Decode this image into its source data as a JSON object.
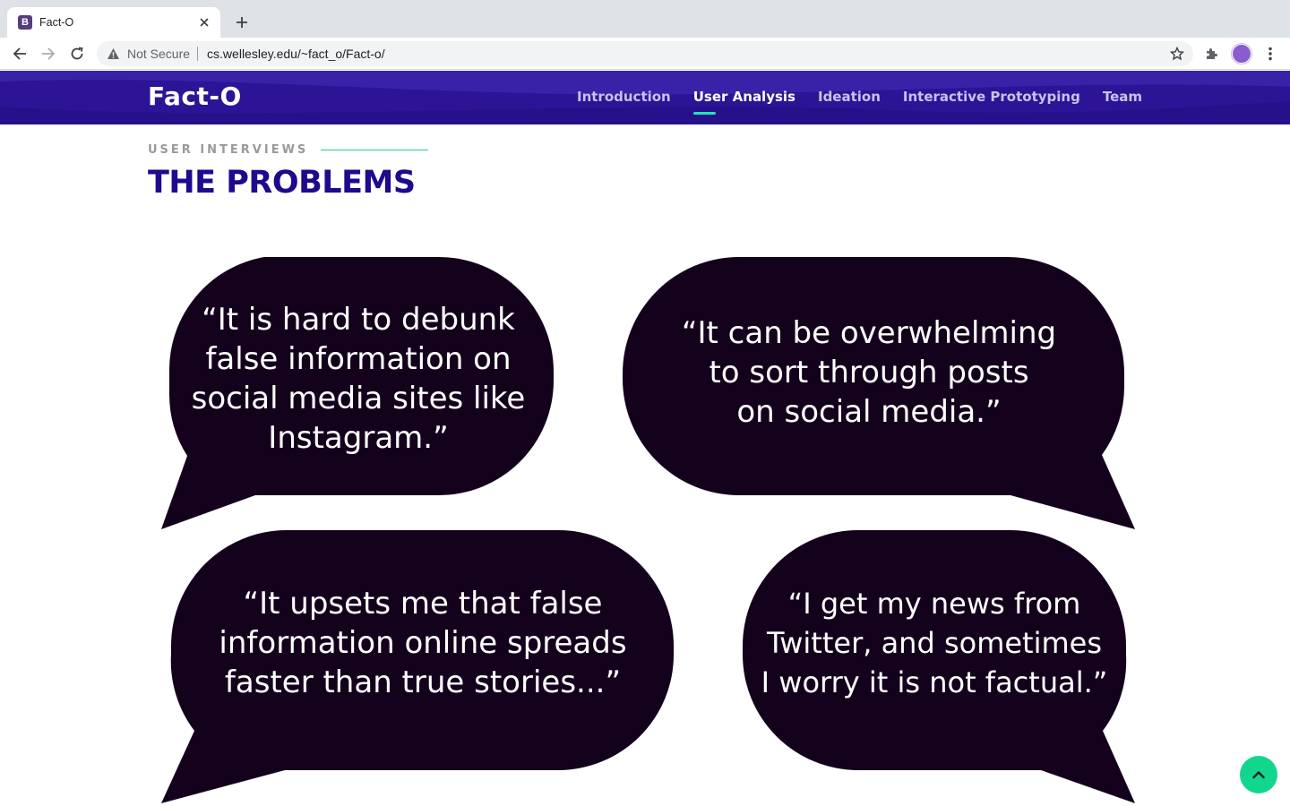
{
  "browser": {
    "tab_title": "Fact-O",
    "tab_favicon_letter": "B",
    "security_label": "Not Secure",
    "url": "cs.wellesley.edu/~fact_o/Fact-o/"
  },
  "header": {
    "brand": "Fact-O",
    "nav": [
      {
        "label": "Introduction",
        "active": false
      },
      {
        "label": "User Analysis",
        "active": true
      },
      {
        "label": "Ideation",
        "active": false
      },
      {
        "label": "Interactive Prototyping",
        "active": false
      },
      {
        "label": "Team",
        "active": false
      }
    ]
  },
  "section": {
    "eyebrow": "USER INTERVIEWS",
    "title": "THE PROBLEMS"
  },
  "quotes": [
    {
      "lines": [
        "“It is hard to debunk",
        "false information on",
        "social media sites like",
        "Instagram.”"
      ]
    },
    {
      "lines": [
        "“It can be overwhelming",
        "to sort through posts",
        "on social media.”"
      ]
    },
    {
      "lines": [
        "“It upsets me that false",
        "information online spreads",
        "faster than true stories...”"
      ]
    },
    {
      "lines": [
        "“I get my news from",
        "Twitter, and sometimes",
        "I worry it is not factual.”"
      ]
    }
  ],
  "colors": {
    "header_bg": "#2d1497",
    "title": "#1e0a8c",
    "accent": "#1de9b6",
    "bubble": "#14021c",
    "back_to_top": "#12d68e"
  },
  "icons": {
    "back_to_top": "chevron-up-icon"
  }
}
